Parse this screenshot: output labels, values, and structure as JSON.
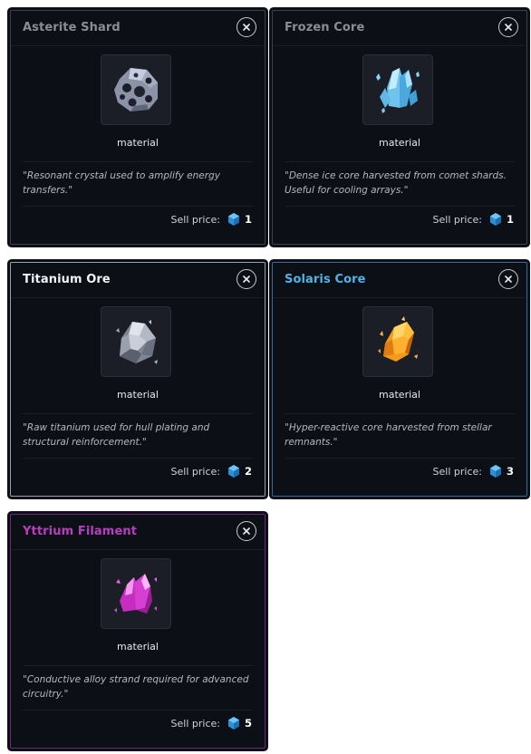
{
  "cards": [
    {
      "title": "Asterite Shard",
      "title_color": "#8a8d96",
      "border_color": "#3b4049",
      "icon": "asterite-rock-icon",
      "kind": "material",
      "description": "\"Resonant crystal used to amplify energy transfers.\"",
      "sell_label": "Sell price:",
      "price": "1"
    },
    {
      "title": "Frozen Core",
      "title_color": "#8a8d96",
      "border_color": "#3b4049",
      "icon": "ice-crystal-icon",
      "kind": "material",
      "description": "\"Dense ice core harvested from comet shards. Useful for cooling arrays.\"",
      "sell_label": "Sell price:",
      "price": "1"
    },
    {
      "title": "Titanium Ore",
      "title_color": "#f2f3f5",
      "border_color": "#9aa0ab",
      "icon": "titanium-ore-icon",
      "kind": "material",
      "description": "\"Raw titanium used for hull plating and structural reinforcement.\"",
      "sell_label": "Sell price:",
      "price": "2"
    },
    {
      "title": "Solaris Core",
      "title_color": "#4fb3e3",
      "border_color": "#2a6f96",
      "icon": "amber-crystal-icon",
      "kind": "material",
      "description": "\"Hyper-reactive core harvested from stellar remnants.\"",
      "sell_label": "Sell price:",
      "price": "3"
    },
    {
      "title": "Yttrium Filament",
      "title_color": "#b73fbf",
      "border_color": "#6a2a78",
      "icon": "magenta-crystal-icon",
      "kind": "material",
      "description": "\"Conductive alloy strand required for advanced circuitry.\"",
      "sell_label": "Sell price:",
      "price": "5"
    }
  ],
  "currency_icon": "blue-hexagon-gem-icon",
  "currency_color": "#3aa0e4"
}
